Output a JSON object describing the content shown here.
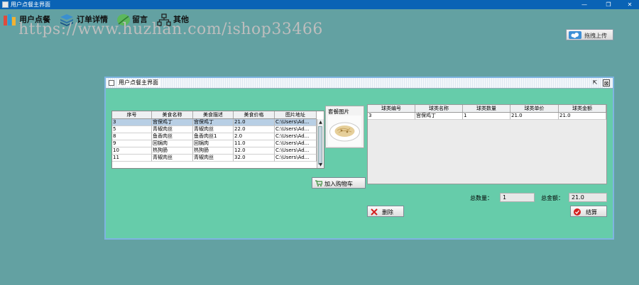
{
  "window": {
    "title": "用户点餐主界面",
    "controls": [
      "—",
      "❐",
      "✕"
    ]
  },
  "toolbar": {
    "items": [
      {
        "label": "用户点餐",
        "icon": "books-icon"
      },
      {
        "label": "订单详情",
        "icon": "layers-icon"
      },
      {
        "label": "留言",
        "icon": "leaf-icon"
      },
      {
        "label": "其他",
        "icon": "hierarchy-icon"
      }
    ],
    "upload_label": "拖拽上传"
  },
  "watermark": "https://www.huzhan.com/ishop33466",
  "inner_window": {
    "title": "用户点餐主界面",
    "buttons": [
      "⇱",
      "⊠"
    ]
  },
  "menu_table": {
    "columns": [
      "序号",
      "美食名称",
      "美食描述",
      "美食价格",
      "图片地址"
    ],
    "rows": [
      [
        "3",
        "宫保鸡丁",
        "宫保鸡丁",
        "21.0",
        "C:\\Users\\Ad..."
      ],
      [
        "5",
        "青椒肉丝",
        "青椒肉丝",
        "22.0",
        "C:\\Users\\Ad..."
      ],
      [
        "8",
        "鱼香肉丝",
        "鱼香肉丝1",
        "2.0",
        "C:\\Users\\Ad..."
      ],
      [
        "9",
        "回锅肉",
        "回锅肉",
        "11.0",
        "C:\\Users\\Ad..."
      ],
      [
        "10",
        "热狗肠",
        "热狗肠",
        "12.0",
        "C:\\Users\\Ad..."
      ],
      [
        "11",
        "青椒肉丝",
        "青椒肉丝",
        "32.0",
        "C:\\Users\\Ad..."
      ]
    ],
    "selected_row": 0
  },
  "photo": {
    "label": "套餐图片"
  },
  "add_to_cart_label": "加入购物车",
  "cart_table": {
    "columns": [
      "球类编号",
      "球类名称",
      "球类数量",
      "球类单价",
      "球类金额"
    ],
    "rows": [
      [
        "3",
        "宫保鸡丁",
        "1",
        "21.0",
        "21.0"
      ]
    ]
  },
  "totals": {
    "count_label": "总数量：",
    "count_value": "1",
    "amount_label": "总金额：",
    "amount_value": "21.0"
  },
  "delete_label": "删除",
  "checkout_label": "结算",
  "colors": {
    "desktop": "#63a1a2",
    "window_bg": "#66ccaa",
    "titlebar": "#0a63b5",
    "selection": "#b8cfe5"
  }
}
